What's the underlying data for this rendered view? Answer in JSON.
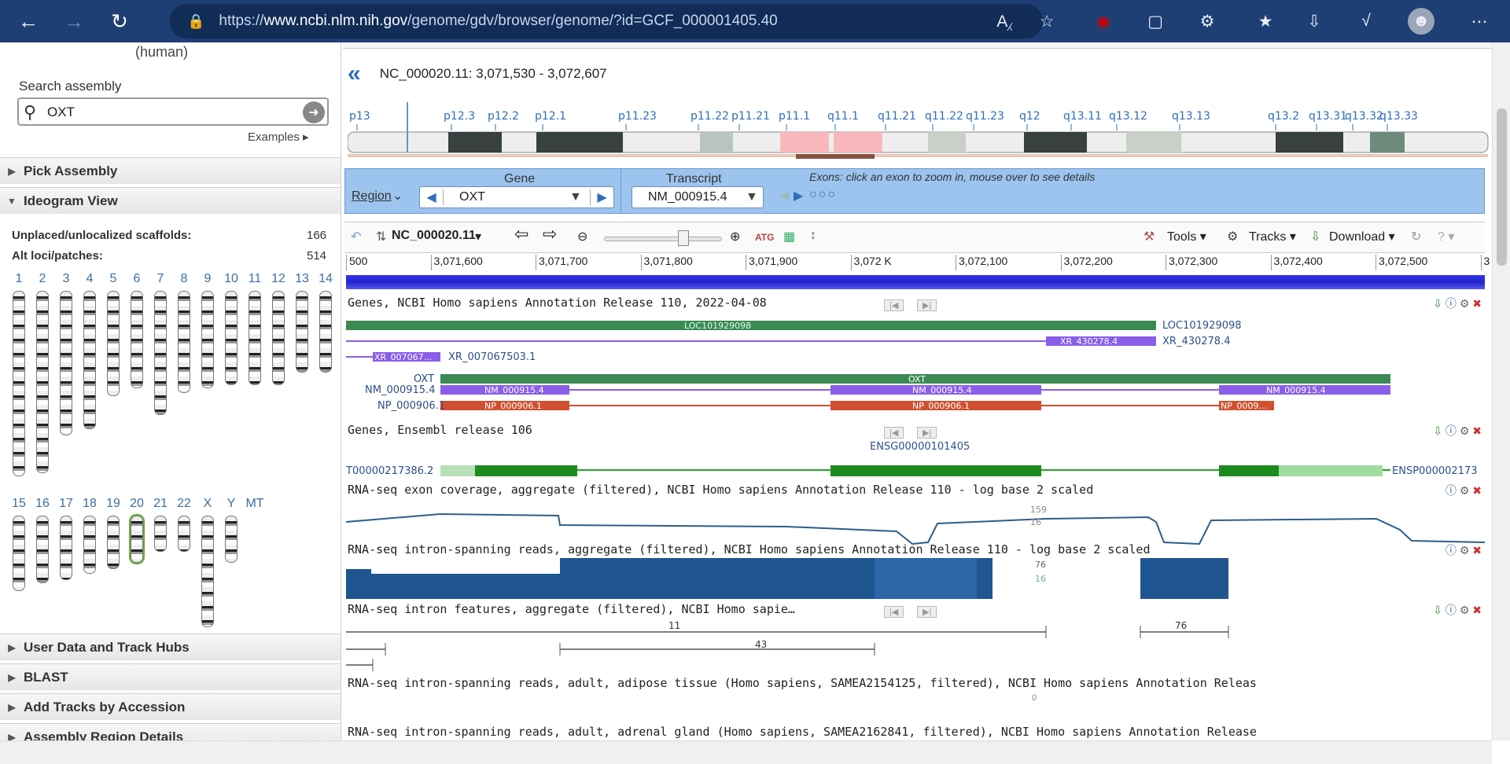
{
  "browser": {
    "url_prefix": "https://",
    "url_host": "www.ncbi.nlm.nih.gov",
    "url_path": "/genome/gdv/browser/genome/?id=GCF_000001405.40"
  },
  "left": {
    "species": "(human)",
    "search_label": "Search assembly",
    "search_value": "OXT",
    "examples_label": "Examples",
    "pick_assembly": "Pick Assembly",
    "ideogram_view": "Ideogram View",
    "unplaced_label": "Unplaced/unlocalized scaffolds:",
    "unplaced_value": "166",
    "altloci_label": "Alt loci/patches:",
    "altloci_value": "514",
    "chromosomes_row1": [
      "1",
      "2",
      "3",
      "4",
      "5",
      "6",
      "7",
      "8",
      "9",
      "10",
      "11",
      "12",
      "13",
      "14"
    ],
    "chromosomes_row2": [
      "15",
      "16",
      "17",
      "18",
      "19",
      "20",
      "21",
      "22",
      "X",
      "Y",
      "MT"
    ],
    "user_data": "User Data and Track Hubs",
    "blast": "BLAST",
    "add_tracks": "Add Tracks by Accession",
    "assembly_region": "Assembly Region Details"
  },
  "viewer": {
    "seq_location": "NC_000020.11:  3,071,530 - 3,072,607",
    "bands": [
      "p13",
      "p12.3",
      "p12.2",
      "p12.1",
      "p11.23",
      "p11.22",
      "p11.21",
      "p11.1",
      "q11.1",
      "q11.21",
      "q11.22",
      "q11.23",
      "q12",
      "q13.11",
      "q13.12",
      "q13.13",
      "q13.2",
      "q13.31",
      "q13.32",
      "q13.33"
    ],
    "region_label": "Region",
    "gene_label": "Gene",
    "gene_value": "OXT",
    "transcript_label": "Transcript",
    "transcript_value": "NM_000915.4",
    "exons_hint": "Exons: click an exon to zoom in, mouse over to see details",
    "seq_name": "NC_000020.11",
    "tools": "Tools",
    "tracks": "Tracks",
    "download": "Download",
    "ruler": [
      "500",
      "3,071,600",
      "3,071,700",
      "3,071,800",
      "3,071,900",
      "3,072 K",
      "3,072,100",
      "3,072,200",
      "3,072,300",
      "3,072,400",
      "3,072,500",
      "3"
    ],
    "track_titles": [
      "Genes, NCBI Homo sapiens Annotation Release 110, 2022-04-08",
      "Genes, Ensembl release 106",
      "RNA-seq exon coverage, aggregate (filtered), NCBI Homo sapiens Annotation Release 110 - log base 2 scaled",
      "RNA-seq intron-spanning reads, aggregate (filtered), NCBI Homo sapiens Annotation Release 110 - log base 2 scaled",
      "RNA-seq intron features, aggregate (filtered), NCBI Homo sapie…",
      "RNA-seq intron-spanning reads, adult, adipose tissue (Homo sapiens, SAMEA2154125, filtered), NCBI Homo sapiens Annotation Releas",
      "RNA-seq intron-spanning reads, adult, adrenal gland (Homo sapiens, SAMEA2162841, filtered), NCBI Homo sapiens Annotation Release"
    ],
    "feature_labels": {
      "loc": "LOC101929098",
      "xr1": "XR_430278.4",
      "xr2": "XR_007067...",
      "xr2_full": "XR_007067503.1",
      "oxt": "OXT",
      "nm": "NM_000915.4",
      "np": "NP_000906.1",
      "np_trunc": "NP_0009...",
      "ens_gene": "ENSG00000101405",
      "ens_tx": "T00000217386.2",
      "ens_prot": "ENSP000002173",
      "cov_max": "159",
      "cov_min": "16",
      "junc_max": "76",
      "junc_min": "16",
      "junc_a": "11",
      "junc_b": "43",
      "junc_c": "76",
      "zero": "0"
    }
  }
}
